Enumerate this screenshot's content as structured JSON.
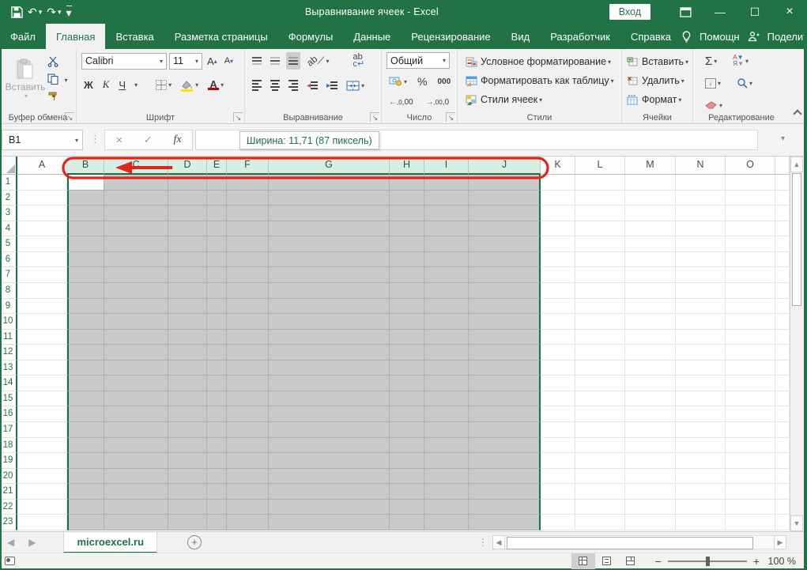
{
  "titlebar": {
    "title": "Выравнивание ячеек  -  Excel",
    "sign_in": "Вход"
  },
  "tabs": {
    "items": [
      {
        "label": "Файл"
      },
      {
        "label": "Главная"
      },
      {
        "label": "Вставка"
      },
      {
        "label": "Разметка страницы"
      },
      {
        "label": "Формулы"
      },
      {
        "label": "Данные"
      },
      {
        "label": "Рецензирование"
      },
      {
        "label": "Вид"
      },
      {
        "label": "Разработчик"
      },
      {
        "label": "Справка"
      }
    ],
    "helper": "Помощн",
    "share": "Поделиться"
  },
  "ribbon": {
    "clipboard": {
      "paste": "Вставить",
      "label": "Буфер обмена"
    },
    "font": {
      "family": "Calibri",
      "size": "11",
      "bold": "Ж",
      "italic": "К",
      "underline": "Ч",
      "grow": "A",
      "shrink": "A",
      "label": "Шрифт"
    },
    "alignment": {
      "orient": "ab",
      "wrap": "ab",
      "label": "Выравнивание"
    },
    "number": {
      "format": "Общий",
      "percent": "%",
      "thousand": "000",
      "dec_left": ",0",
      "dec_left2": ",00",
      "dec_right": ",00",
      "dec_right2": ",0",
      "label": "Число"
    },
    "styles": {
      "conditional": "Условное форматирование",
      "as_table": "Форматировать как таблицу",
      "cell_styles": "Стили ячеек",
      "label": "Стили"
    },
    "cells": {
      "insert": "Вставить",
      "delete": "Удалить",
      "format": "Формат",
      "label": "Ячейки"
    },
    "editing": {
      "sigma": "Σ",
      "sort": "АЯ",
      "label": "Редактирование"
    }
  },
  "formula_bar": {
    "name_box": "B1",
    "cancel": "×",
    "enter": "✓",
    "fx": "fx",
    "tooltip": "Ширина: 11,71 (87 пиксель)"
  },
  "grid": {
    "active_cell": "B1",
    "rows_visible": 23,
    "columns": [
      {
        "letter": "A",
        "selected": false
      },
      {
        "letter": "B",
        "selected": true
      },
      {
        "letter": "C",
        "selected": true
      },
      {
        "letter": "D",
        "selected": true
      },
      {
        "letter": "E",
        "selected": true
      },
      {
        "letter": "F",
        "selected": true
      },
      {
        "letter": "G",
        "selected": true
      },
      {
        "letter": "H",
        "selected": true
      },
      {
        "letter": "I",
        "selected": true
      },
      {
        "letter": "J",
        "selected": true
      },
      {
        "letter": "K",
        "selected": false
      },
      {
        "letter": "L",
        "selected": false
      },
      {
        "letter": "M",
        "selected": false
      },
      {
        "letter": "N",
        "selected": false
      },
      {
        "letter": "O",
        "selected": false
      },
      {
        "letter": "",
        "selected": false
      }
    ]
  },
  "sheet_bar": {
    "tab": "microexcel.ru"
  },
  "status_bar": {
    "zoom_level": "100 %"
  },
  "colors": {
    "excel_green": "#217346",
    "selection_fill": "#c9c9c9",
    "selected_header_bg": "#d8eee3",
    "annotation_red": "#e1251b",
    "highlight_yellow": "#ffe400",
    "font_color_red": "#c00000"
  }
}
